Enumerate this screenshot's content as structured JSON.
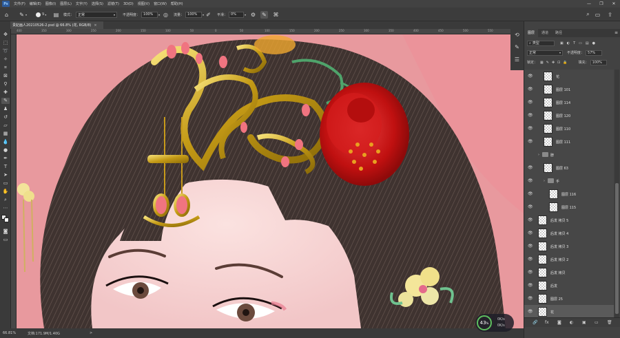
{
  "menu": {
    "logo": "Ps",
    "items": [
      "文件(F)",
      "编辑(E)",
      "图像(I)",
      "图层(L)",
      "文字(Y)",
      "选择(S)",
      "滤镜(T)",
      "3D(D)",
      "视图(V)",
      "窗口(W)",
      "帮助(H)"
    ]
  },
  "window_controls": {
    "minimize": "—",
    "restore": "❐",
    "close": "✕"
  },
  "options": {
    "brush_size": "9",
    "mode_label": "模式：",
    "mode_value": "正常",
    "opacity_label": "不透明度：",
    "opacity_value": "100%",
    "flow_label": "流量：",
    "flow_value": "100%",
    "smooth_label": "平滑：",
    "smooth_value": "0%"
  },
  "document_tab": {
    "title": "贵妃画人20210526-2.psd @ 66.8% (花, RGB/8)",
    "close": "×"
  },
  "rulers": {
    "h_ticks": [
      "400",
      "350",
      "300",
      "250",
      "200",
      "150",
      "100",
      "50",
      "0",
      "50",
      "100",
      "150",
      "200",
      "250",
      "300",
      "350",
      "400",
      "450",
      "500",
      "550",
      "600"
    ]
  },
  "status": {
    "zoom": "66.81%",
    "doc_info": "文档:171.9M/1.40G",
    "arrow": ">"
  },
  "layers_panel": {
    "tabs": [
      "图层",
      "通道",
      "路径"
    ],
    "active_tab": "图层",
    "filter_label": "类型",
    "blend_mode": "正常",
    "opacity_label": "不透明度：",
    "opacity_value": "57%",
    "lock_label": "锁定：",
    "fill_label": "填充：",
    "fill_value": "100%",
    "layers": [
      {
        "name": "花",
        "type": "layer",
        "indent": 1,
        "visible": true,
        "selected": false
      },
      {
        "name": "图层 101",
        "type": "layer",
        "indent": 1,
        "visible": true,
        "selected": false
      },
      {
        "name": "图层 114",
        "type": "layer",
        "indent": 1,
        "visible": true,
        "selected": false
      },
      {
        "name": "图层 120",
        "type": "layer",
        "indent": 1,
        "visible": true,
        "selected": false
      },
      {
        "name": "图层 110",
        "type": "layer",
        "indent": 1,
        "visible": true,
        "selected": false
      },
      {
        "name": "图层 111",
        "type": "layer",
        "indent": 1,
        "visible": true,
        "selected": false
      },
      {
        "name": "脖",
        "type": "group",
        "indent": 0,
        "visible": false,
        "selected": false
      },
      {
        "name": "图层 63",
        "type": "layer",
        "indent": 1,
        "visible": true,
        "selected": false
      },
      {
        "name": "手",
        "type": "group",
        "indent": 1,
        "visible": true,
        "selected": false
      },
      {
        "name": "图层 116",
        "type": "layer",
        "indent": 2,
        "visible": true,
        "selected": false
      },
      {
        "name": "图层 115",
        "type": "layer",
        "indent": 2,
        "visible": true,
        "selected": false
      },
      {
        "name": "后发 拷贝 5",
        "type": "layer",
        "indent": 0,
        "visible": true,
        "selected": false
      },
      {
        "name": "后发 拷贝 4",
        "type": "layer",
        "indent": 0,
        "visible": true,
        "selected": false
      },
      {
        "name": "后发 拷贝 3",
        "type": "layer",
        "indent": 0,
        "visible": true,
        "selected": false
      },
      {
        "name": "后发 拷贝 2",
        "type": "layer",
        "indent": 0,
        "visible": true,
        "selected": false
      },
      {
        "name": "后发 拷贝",
        "type": "layer",
        "indent": 0,
        "visible": true,
        "selected": false
      },
      {
        "name": "后发",
        "type": "layer",
        "indent": 0,
        "visible": true,
        "selected": false
      },
      {
        "name": "图层 25",
        "type": "layer",
        "indent": 0,
        "visible": true,
        "selected": false
      },
      {
        "name": "花",
        "type": "layer",
        "indent": 0,
        "visible": true,
        "selected": true
      }
    ],
    "footer_icons": [
      "🔗",
      "fx",
      "◙",
      "◐",
      "▣",
      "▭",
      "🗑"
    ]
  },
  "performance": {
    "percent": "43",
    "unit": "%",
    "up": "0K/s",
    "down": "0K/s"
  }
}
